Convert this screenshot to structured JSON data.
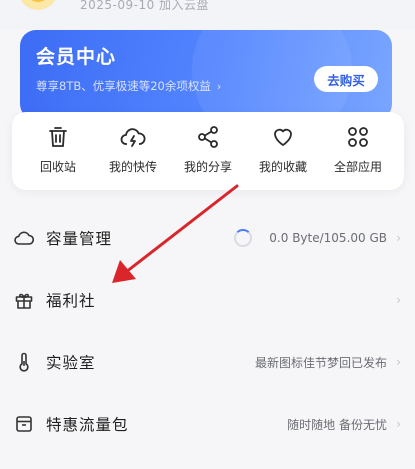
{
  "header": {
    "join_date": "2025-09-10 加入云盘"
  },
  "vip": {
    "title": "会员中心",
    "subtitle": "尊享8TB、优享极速等20余项权益",
    "buy_label": "去购买",
    "accent": "#4A78F7"
  },
  "shortcuts": [
    {
      "label": "回收站",
      "icon": "trash-icon"
    },
    {
      "label": "我的快传",
      "icon": "cloud-lightning-icon"
    },
    {
      "label": "我的分享",
      "icon": "share-icon"
    },
    {
      "label": "我的收藏",
      "icon": "heart-icon"
    },
    {
      "label": "全部应用",
      "icon": "apps-grid-icon"
    }
  ],
  "menu": [
    {
      "label": "容量管理",
      "value": "0.0 Byte/105.00 GB",
      "icon": "cloud-icon"
    },
    {
      "label": "福利社",
      "value": "",
      "icon": "gift-icon"
    },
    {
      "label": "实验室",
      "value": "最新图标佳节梦回已发布",
      "icon": "thermometer-icon"
    },
    {
      "label": "特惠流量包",
      "value": "随时随地 备份无忧",
      "icon": "data-package-icon"
    }
  ],
  "annotation": {
    "color": "#D9262C"
  }
}
